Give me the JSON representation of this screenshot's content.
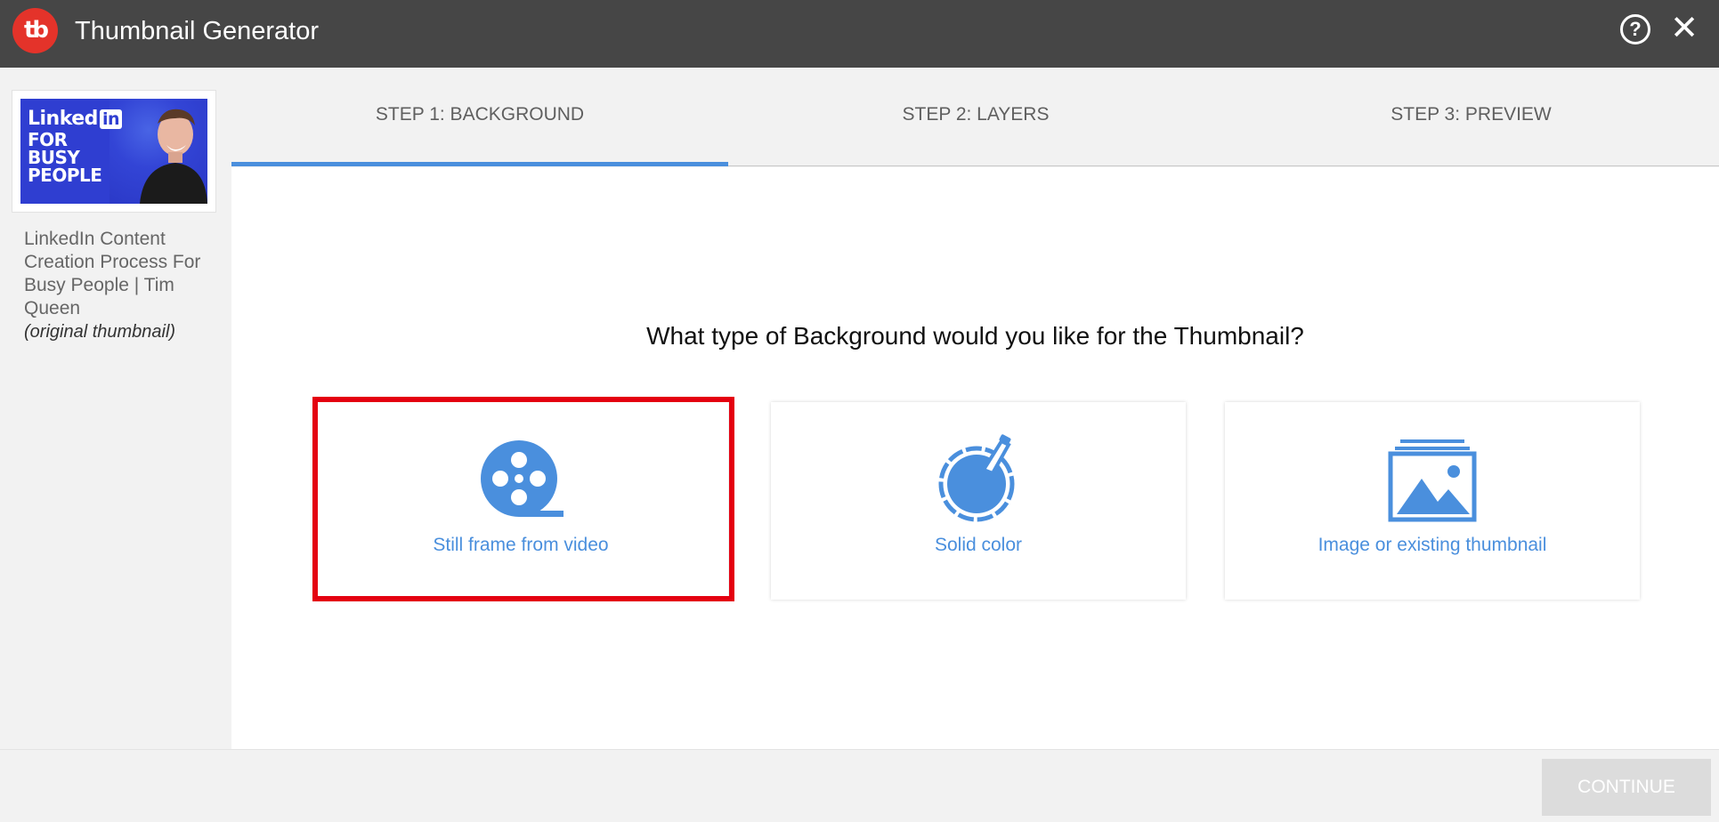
{
  "window": {
    "logo_text": "tb",
    "title": "Thumbnail Generator",
    "help_icon": "question-circle-icon",
    "close_icon": "close-icon"
  },
  "sidebar": {
    "thumbnail_text": {
      "line1": "Linked",
      "line1_badge": "in",
      "line2": "FOR",
      "line3": "BUSY",
      "line4": "PEOPLE"
    },
    "video_title": "LinkedIn Content Creation Process For Busy People | Tim Queen",
    "video_note": "(original thumbnail)"
  },
  "steps": [
    {
      "label": "STEP 1: BACKGROUND",
      "active": true
    },
    {
      "label": "STEP 2: LAYERS",
      "active": false
    },
    {
      "label": "STEP 3: PREVIEW",
      "active": false
    }
  ],
  "main": {
    "question": "What type of Background would you like for the Thumbnail?",
    "options": [
      {
        "label": "Still frame from video",
        "icon": "film-reel-icon",
        "highlighted": true
      },
      {
        "label": "Solid color",
        "icon": "color-dropper-icon",
        "highlighted": false
      },
      {
        "label": "Image or existing thumbnail",
        "icon": "image-stack-icon",
        "highlighted": false
      }
    ]
  },
  "footer": {
    "continue_label": "CONTINUE",
    "continue_enabled": false
  },
  "colors": {
    "titlebar": "#464646",
    "brand_red": "#e4332a",
    "accent_blue": "#4a8fdd",
    "highlight_red": "#e40010",
    "sidebar_bg": "#f2f2f2"
  }
}
